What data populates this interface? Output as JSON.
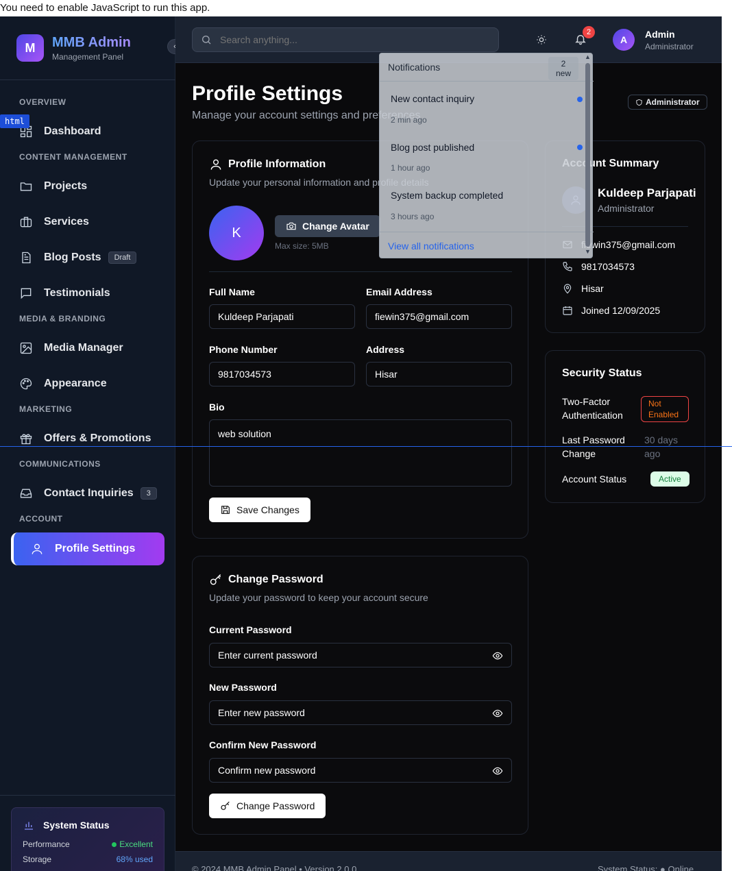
{
  "noscript": "You need to enable JavaScript to run this app.",
  "brand": {
    "logo": "M",
    "title": "MMB Admin",
    "subtitle": "Management Panel"
  },
  "sidebar": {
    "sections": [
      "OVERVIEW",
      "CONTENT MANAGEMENT",
      "MEDIA & BRANDING",
      "MARKETING",
      "COMMUNICATIONS",
      "ACCOUNT"
    ],
    "items": [
      {
        "label": "Dashboard",
        "icon": "dashboard-icon"
      },
      {
        "label": "Projects",
        "icon": "folder-icon"
      },
      {
        "label": "Services",
        "icon": "briefcase-icon"
      },
      {
        "label": "Blog Posts",
        "icon": "document-icon",
        "badge": "Draft"
      },
      {
        "label": "Testimonials",
        "icon": "message-icon"
      },
      {
        "label": "Media Manager",
        "icon": "image-icon"
      },
      {
        "label": "Appearance",
        "icon": "palette-icon"
      },
      {
        "label": "Offers & Promotions",
        "icon": "gift-icon"
      },
      {
        "label": "Contact Inquiries",
        "icon": "inbox-icon",
        "badge": "3"
      },
      {
        "label": "Profile Settings",
        "icon": "user-icon",
        "active": true
      }
    ],
    "system_status": {
      "title": "System Status",
      "performance_label": "Performance",
      "performance_value": "Excellent",
      "storage_label": "Storage",
      "storage_value": "68% used"
    }
  },
  "header": {
    "search_placeholder": "Search anything...",
    "notification_count": "2",
    "avatar_initial": "A",
    "user_name": "Admin",
    "user_role": "Administrator"
  },
  "page": {
    "title": "Profile Settings",
    "subtitle": "Manage your account settings and preferences",
    "role_badge": "Administrator"
  },
  "profile_info": {
    "title": "Profile Information",
    "description": "Update your personal information and profile details",
    "avatar_initial": "K",
    "change_avatar": "Change Avatar",
    "max_size": "Max size: 5MB",
    "full_name_label": "Full Name",
    "full_name": "Kuldeep Parjapati",
    "email_label": "Email Address",
    "email": "fiewin375@gmail.com",
    "phone_label": "Phone Number",
    "phone": "9817034573",
    "address_label": "Address",
    "address": "Hisar",
    "bio_label": "Bio",
    "bio": "web solution",
    "save_button": "Save Changes"
  },
  "change_password": {
    "title": "Change Password",
    "description": "Update your password to keep your account secure",
    "current_label": "Current Password",
    "current_placeholder": "Enter current password",
    "new_label": "New Password",
    "new_placeholder": "Enter new password",
    "confirm_label": "Confirm New Password",
    "confirm_placeholder": "Confirm new password",
    "button": "Change Password"
  },
  "account_summary": {
    "title": "Account Summary",
    "name": "Kuldeep Parjapati",
    "role": "Administrator",
    "email": "fiewin375@gmail.com",
    "phone": "9817034573",
    "location": "Hisar",
    "joined": "Joined 12/09/2025"
  },
  "security_status": {
    "title": "Security Status",
    "two_factor_label_1": "Two-Factor",
    "two_factor_label_2": "Authentication",
    "two_factor_value_1": "Not",
    "two_factor_value_2": "Enabled",
    "last_pw_label_1": "Last Password",
    "last_pw_label_2": "Change",
    "last_pw_value_1": "30 days",
    "last_pw_value_2": "ago",
    "account_status_label": "Account Status",
    "account_status_value": "Active"
  },
  "notifications": {
    "title": "Notifications",
    "new_count": "2",
    "new_label": "new",
    "items": [
      {
        "title": "New contact inquiry",
        "time": "2 min ago",
        "unread": true
      },
      {
        "title": "Blog post published",
        "time": "1 hour ago",
        "unread": true
      },
      {
        "title": "System backup completed",
        "time": "3 hours ago",
        "unread": false
      }
    ],
    "view_all": "View all notifications"
  },
  "footer": {
    "left": "© 2024 MMB Admin Panel  •  Version 2.0.0",
    "right": "System Status: ● Online"
  },
  "devtools": {
    "tag": "html"
  },
  "colors": {
    "accent_start": "#3b63f0",
    "accent_end": "#a23bf0",
    "danger": "#ef4444",
    "success": "#22c55e",
    "link": "#2563eb"
  }
}
